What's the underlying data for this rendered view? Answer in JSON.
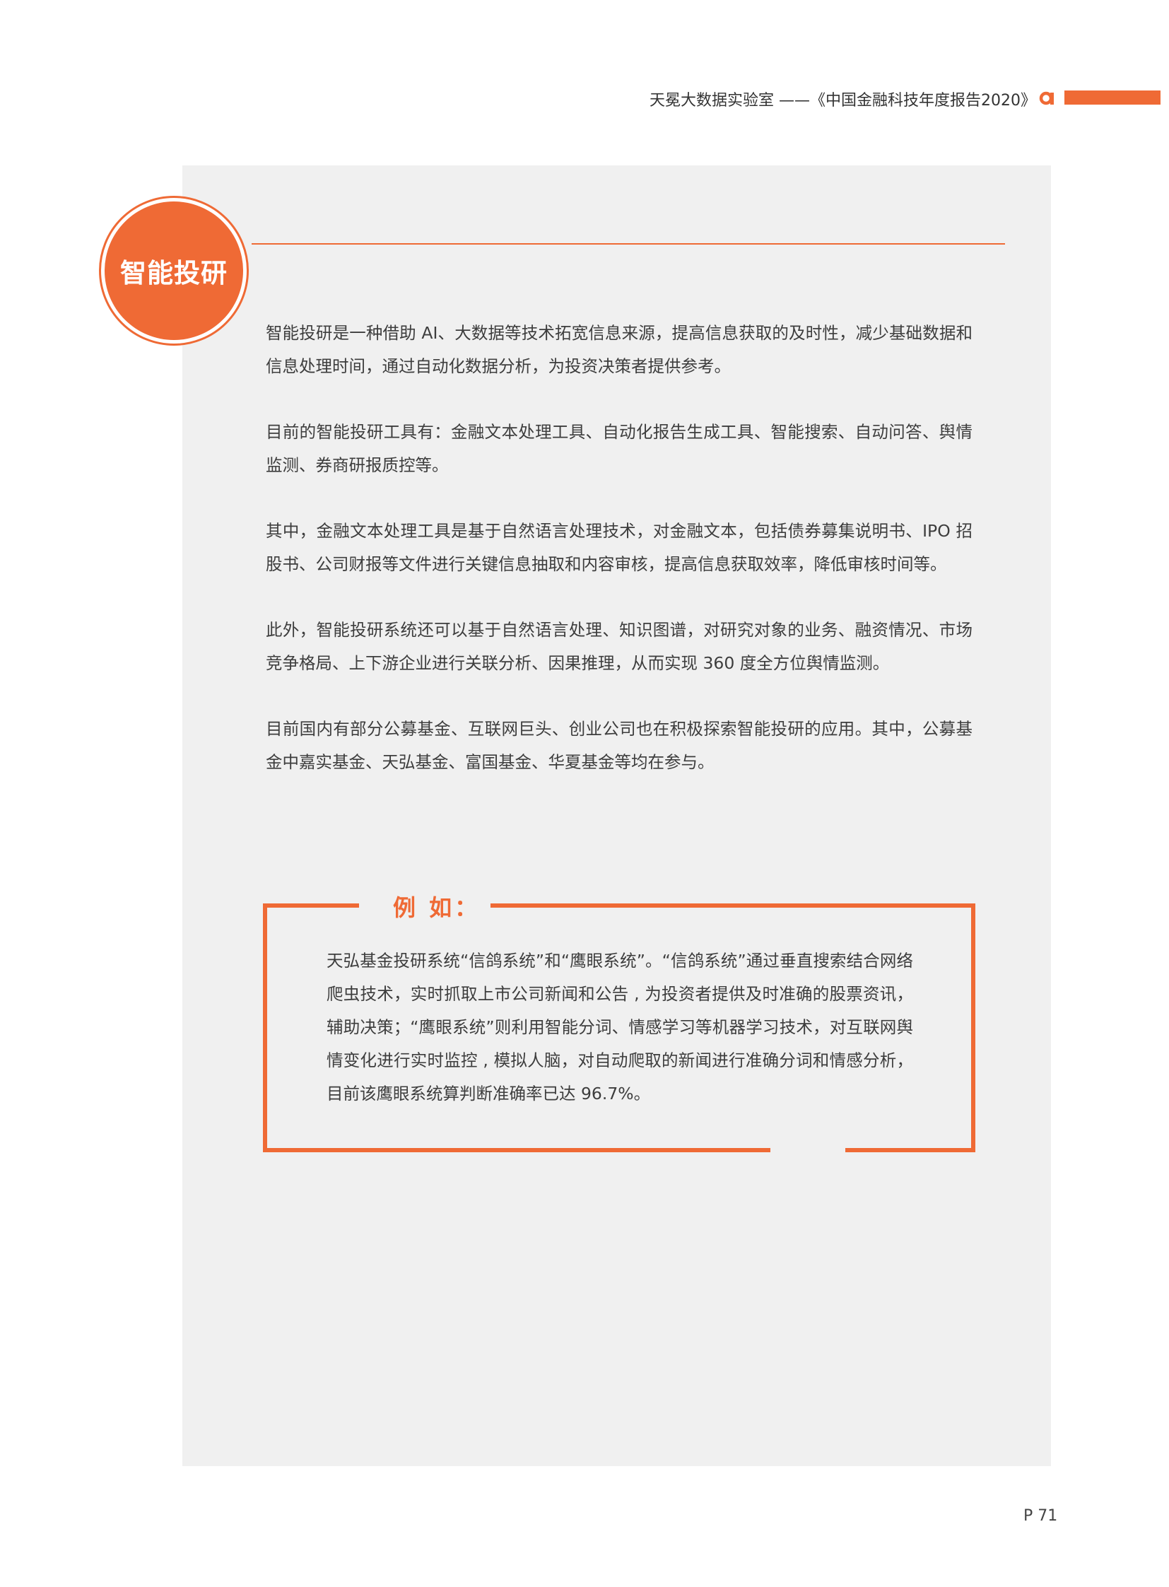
{
  "header": {
    "title": "天冕大数据实验室 ——《中国金融科技年度报告2020》",
    "logo_icon": "brand-a-icon",
    "accent_color": "#ef6a35"
  },
  "section": {
    "title": "智能投研"
  },
  "paragraphs": [
    "智能投研是一种借助 AI、大数据等技术拓宽信息来源，提高信息获取的及时性，减少基础数据和信息处理时间，通过自动化数据分析，为投资决策者提供参考。",
    "目前的智能投研工具有：金融文本处理工具、自动化报告生成工具、智能搜索、自动问答、舆情监测、券商研报质控等。",
    "其中，金融文本处理工具是基于自然语言处理技术，对金融文本，包括债券募集说明书、IPO 招股书、公司财报等文件进行关键信息抽取和内容审核，提高信息获取效率，降低审核时间等。",
    "此外，智能投研系统还可以基于自然语言处理、知识图谱，对研究对象的业务、融资情况、市场竞争格局、上下游企业进行关联分析、因果推理，从而实现 360 度全方位舆情监测。",
    "目前国内有部分公募基金、互联网巨头、创业公司也在积极探索智能投研的应用。其中，公募基金中嘉实基金、天弘基金、富国基金、华夏基金等均在参与。"
  ],
  "example": {
    "label": "例 如：",
    "text": "天弘基金投研系统“信鸽系统”和“鹰眼系统”。“信鸽系统”通过垂直搜索结合网络爬虫技术，实时抓取上市公司新闻和公告 , 为投资者提供及时准确的股票资讯，辅助决策；“鹰眼系统”则利用智能分词、情感学习等机器学习技术，对互联网舆情变化进行实时监控 , 模拟人脑，对自动爬取的新闻进行准确分词和情感分析，目前该鹰眼系统算判断准确率已达 96.7%。"
  },
  "footer": {
    "page_number": "P 71"
  }
}
